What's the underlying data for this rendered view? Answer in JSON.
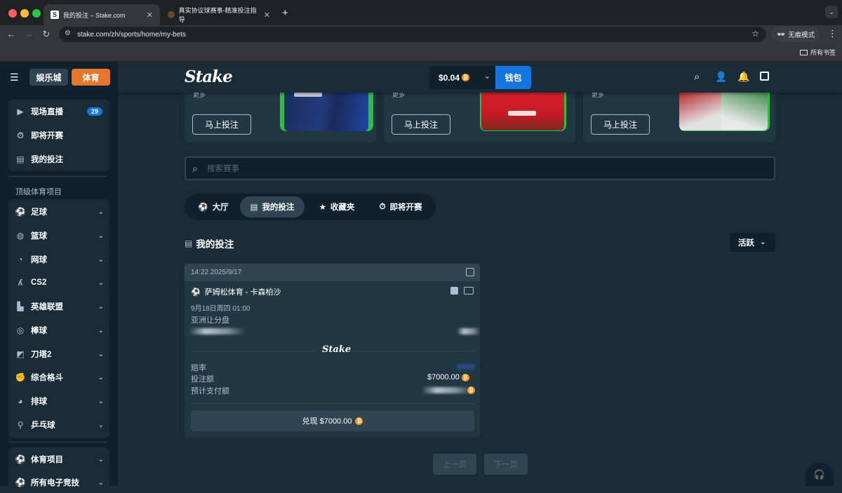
{
  "browser": {
    "tabs": [
      {
        "title": "我的投注 – Stake.com",
        "active": true
      },
      {
        "title": "真实协议球赛事-精准投注指导",
        "active": false
      }
    ],
    "url": "stake.com/zh/sports/home/my-bets",
    "incognito_label": "无痕模式",
    "bookmarks_label": "所有书签"
  },
  "header": {
    "casino_label": "娱乐城",
    "sports_label": "体育",
    "logo": "Stake",
    "balance": "$0.04",
    "wallet_label": "钱包"
  },
  "sidebar": {
    "top_items": [
      {
        "label": "现场直播",
        "icon": "live-icon",
        "badge": "29"
      },
      {
        "label": "即将开赛",
        "icon": "stopwatch-icon"
      },
      {
        "label": "我的投注",
        "icon": "bets-icon"
      }
    ],
    "section_title": "顶级体育项目",
    "sport_items": [
      {
        "label": "足球",
        "icon": "soccer-ball-icon"
      },
      {
        "label": "篮球",
        "icon": "basketball-icon"
      },
      {
        "label": "网球",
        "icon": "tennis-ball-icon"
      },
      {
        "label": "CS2",
        "icon": "cs2-icon"
      },
      {
        "label": "英雄联盟",
        "icon": "lol-icon"
      },
      {
        "label": "棒球",
        "icon": "baseball-icon"
      },
      {
        "label": "刀塔2",
        "icon": "dota2-icon"
      },
      {
        "label": "综合格斗",
        "icon": "mma-icon"
      },
      {
        "label": "排球",
        "icon": "volleyball-icon"
      },
      {
        "label": "乒乓球",
        "icon": "table-tennis-icon"
      }
    ],
    "bottom_items": [
      {
        "label": "体育项目",
        "icon": "sports-icon"
      },
      {
        "label": "所有电子竞技",
        "icon": "esports-icon"
      }
    ]
  },
  "promo_cards": [
    {
      "more": "更多",
      "button": "马上投注"
    },
    {
      "more": "更多",
      "button": "马上投注"
    },
    {
      "more": "更多",
      "button": "马上投注"
    }
  ],
  "search": {
    "placeholder": "搜索赛事"
  },
  "nav_tabs": [
    {
      "label": "大厅",
      "icon": "lobby-icon",
      "active": false
    },
    {
      "label": "我的投注",
      "icon": "bets-icon",
      "active": true
    },
    {
      "label": "收藏夹",
      "icon": "star-icon",
      "active": false
    },
    {
      "label": "即将开赛",
      "icon": "stopwatch-icon",
      "active": false
    }
  ],
  "section": {
    "title": "我的投注",
    "filter": "活跃"
  },
  "bet": {
    "timestamp": "14:22 2025/9/17",
    "match": "萨姆松体育 - 卡森柏沙",
    "date": "9月18日周四 01:00",
    "market": "亚洲让分盘",
    "logo": "Stake",
    "odds_label": "赔率",
    "stake_label": "投注额",
    "stake_value": "$7000.00",
    "payout_label": "预计支付额",
    "cashout_label": "兑现 $7000.00"
  },
  "pagination": {
    "prev": "上一页",
    "next": "下一页"
  },
  "colors": {
    "accent_blue": "#1475e1",
    "accent_orange": "#e4772d",
    "bg": "#1a2c38",
    "sidebar": "#0f212e"
  }
}
